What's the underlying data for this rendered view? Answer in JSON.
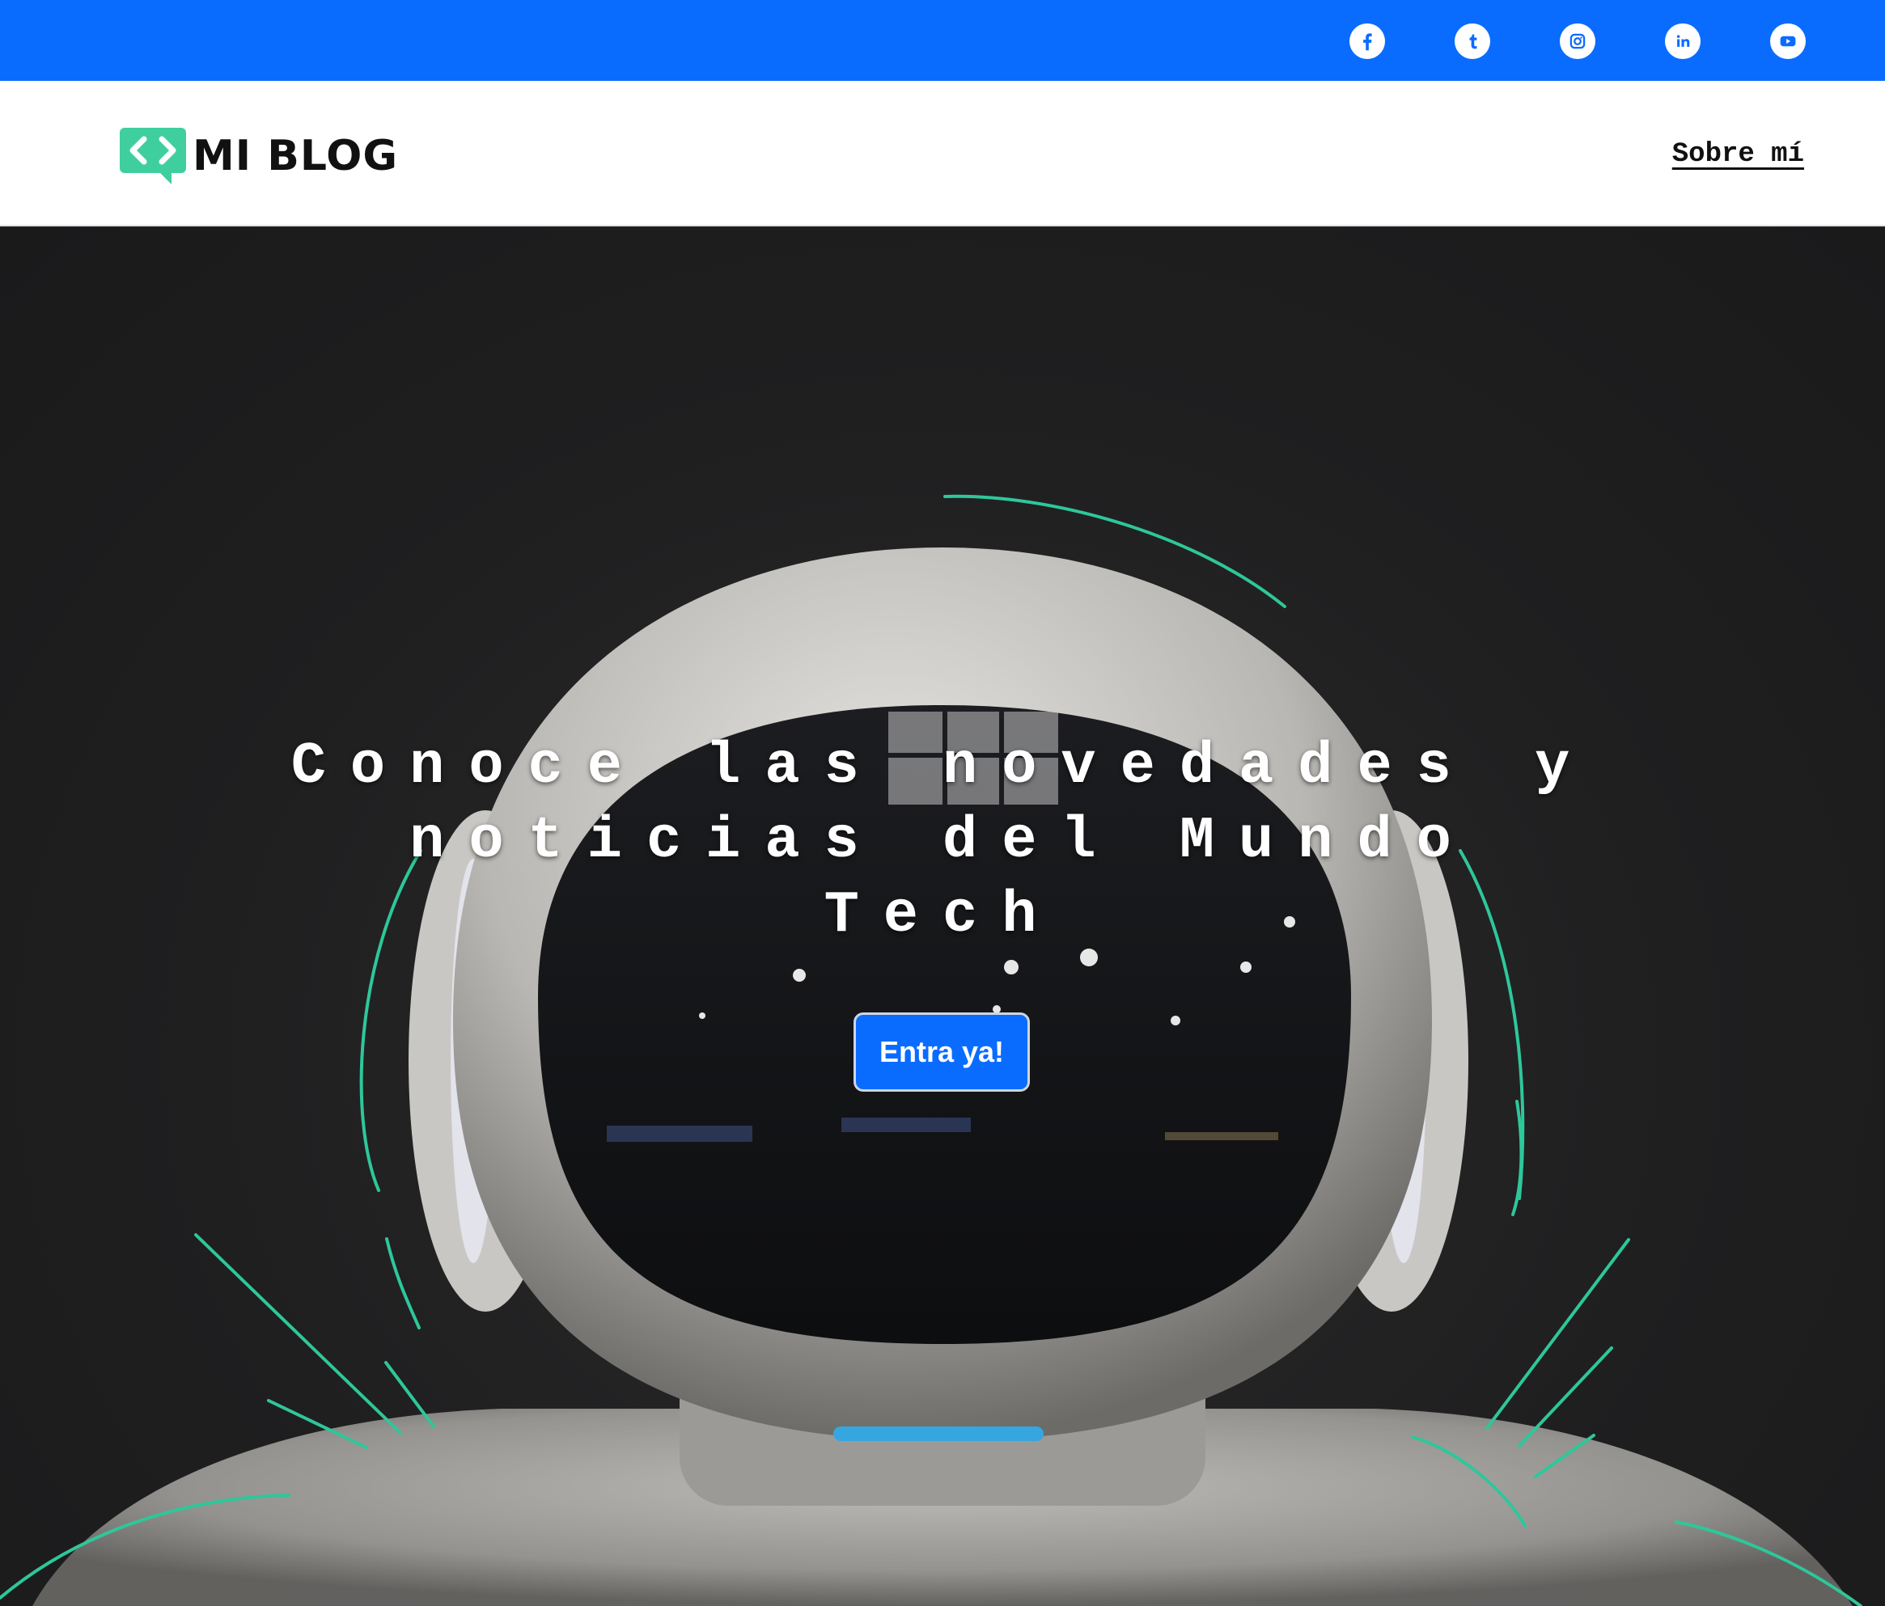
{
  "topbar": {
    "background": "#0a6cff",
    "social_links": [
      {
        "icon": "facebook-icon"
      },
      {
        "icon": "tumblr-icon"
      },
      {
        "icon": "instagram-icon"
      },
      {
        "icon": "linkedin-icon"
      },
      {
        "icon": "youtube-icon"
      }
    ]
  },
  "header": {
    "logo_text": "MI BLOG",
    "logo_color": "#3fcf9e",
    "nav": {
      "about_label": "Sobre mí"
    }
  },
  "hero": {
    "title": "Conoce las novedades y noticias del Mundo Tech",
    "cta_label": "Entra ya!",
    "cta_color": "#0a6cff",
    "accent_line_color": "#2ec79a"
  }
}
